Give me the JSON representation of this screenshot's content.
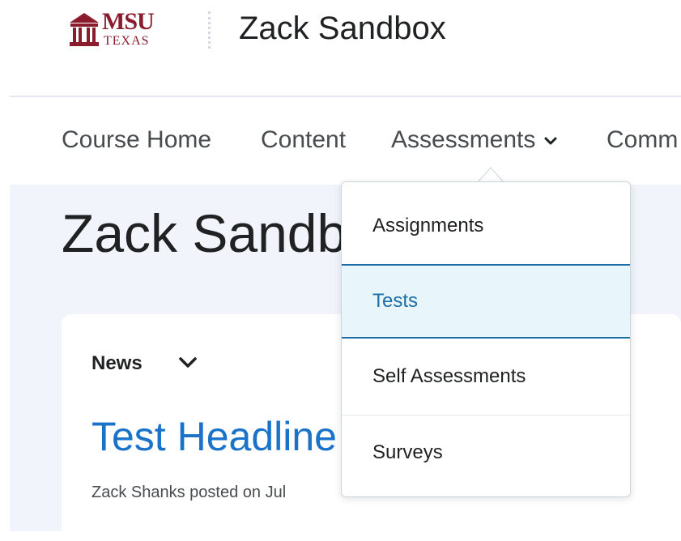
{
  "header": {
    "logo_main": "MSU",
    "logo_sub": "TEXAS",
    "course_title": "Zack Sandbox"
  },
  "nav": {
    "items": [
      {
        "label": "Course Home"
      },
      {
        "label": "Content"
      },
      {
        "label": "Assessments"
      },
      {
        "label": "Comm"
      }
    ]
  },
  "page": {
    "title": "Zack Sandb"
  },
  "widget": {
    "title": "News",
    "headline": "Test Headline",
    "posted": "Zack Shanks posted on Jul"
  },
  "dropdown": {
    "items": [
      {
        "label": "Assignments"
      },
      {
        "label": "Tests"
      },
      {
        "label": "Self Assessments"
      },
      {
        "label": "Surveys"
      }
    ]
  },
  "colors": {
    "brand": "#8a1c2d",
    "link": "#1a73c8",
    "active_border": "#1c6ea4",
    "active_bg": "#e8f6fc",
    "page_bg": "#f1f5fb"
  },
  "icons": {
    "logo": "msu-texas-building-logo",
    "nav_dropdown": "chevron-down-icon",
    "widget_dropdown": "chevron-down-icon"
  }
}
